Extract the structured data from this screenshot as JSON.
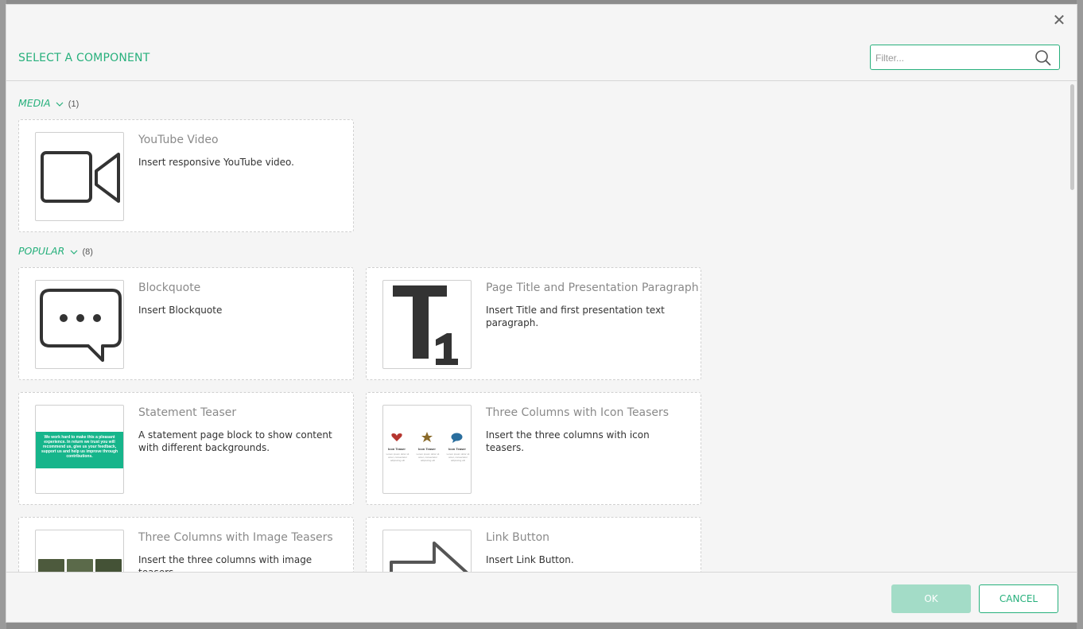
{
  "dialog": {
    "title": "SELECT A COMPONENT",
    "close_icon": "close-icon",
    "filter": {
      "placeholder": "Filter...",
      "value": "",
      "icon": "search-icon"
    }
  },
  "sections": [
    {
      "name": "MEDIA",
      "count": "(1)",
      "items": [
        {
          "title": "YouTube Video",
          "description": "Insert responsive YouTube video.",
          "icon": "video-camera-icon"
        }
      ]
    },
    {
      "name": "POPULAR",
      "count": "(8)",
      "items": [
        {
          "title": "Blockquote",
          "description": "Insert Blockquote",
          "icon": "speech-bubble-icon"
        },
        {
          "title": "Page Title and Presentation Paragraph",
          "description": "Insert Title and first presentation text paragraph.",
          "icon": "title-t1-icon"
        },
        {
          "title": "Statement Teaser",
          "description": "A statement page block to show content with different backgrounds.",
          "icon": "statement-preview"
        },
        {
          "title": "Three Columns with Icon Teasers",
          "description": "Insert the three columns with icon teasers.",
          "icon": "icon-teasers-preview"
        },
        {
          "title": "Three Columns with Image Teasers",
          "description": "Insert the three columns with image teasers.",
          "icon": "image-teasers-preview"
        },
        {
          "title": "Link Button",
          "description": "Insert Link Button.",
          "icon": "arrow-icon"
        }
      ]
    }
  ],
  "previews": {
    "statement_text": "We work hard to make this a pleasant experience. In return we trust you will recommend us, give us your feedback, support us and help us improve through contributions.",
    "icon_teaser_label": "Icon Teaser",
    "icon_teaser_sub": "Lorem ipsum dolor sit amet, consectetur adipiscing elit"
  },
  "footer": {
    "ok_label": "OK",
    "cancel_label": "CANCEL"
  },
  "colors": {
    "accent": "#27b07c",
    "ok_disabled": "#a3dcc7",
    "statement_bg": "#16b58b"
  }
}
